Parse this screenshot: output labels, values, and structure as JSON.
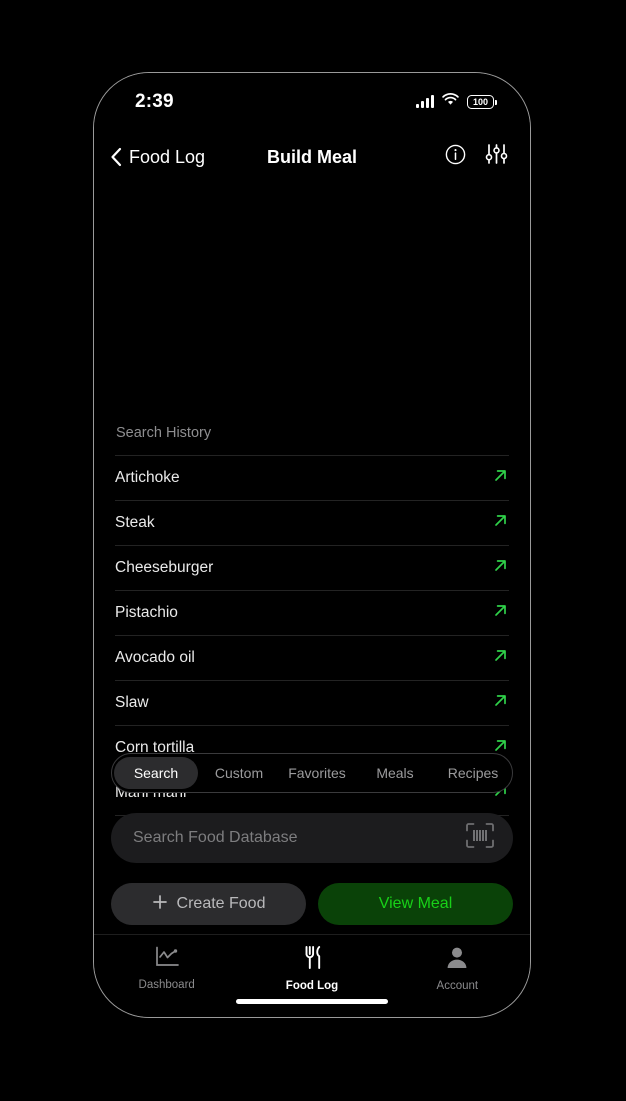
{
  "status_bar": {
    "time": "2:39",
    "signal_icon": "cellular-signal-icon",
    "wifi_icon": "wifi-icon",
    "battery_level": "100"
  },
  "nav": {
    "back_label": "Food Log",
    "back_icon": "chevron-left-icon",
    "title": "Build Meal",
    "info_icon": "info-circle-icon",
    "filter_icon": "sliders-icon"
  },
  "history": {
    "title": "Search History",
    "row_arrow_icon": "arrow-up-right-icon",
    "items": [
      {
        "name": "Artichoke"
      },
      {
        "name": "Steak"
      },
      {
        "name": "Cheeseburger"
      },
      {
        "name": "Pistachio"
      },
      {
        "name": "Avocado oil"
      },
      {
        "name": "Slaw"
      },
      {
        "name": "Corn tortilla"
      },
      {
        "name": "Mahi mahi"
      },
      {
        "name": ""
      }
    ]
  },
  "segmented_control": {
    "selected": "Search",
    "tabs": [
      {
        "label": "Search"
      },
      {
        "label": "Custom"
      },
      {
        "label": "Favorites"
      },
      {
        "label": "Meals"
      },
      {
        "label": "Recipes"
      }
    ]
  },
  "search": {
    "placeholder": "Search Food Database",
    "value": "",
    "barcode_icon": "barcode-scan-icon"
  },
  "actions": {
    "create_food_label": "Create Food",
    "create_food_icon": "plus-icon",
    "view_meal_label": "View Meal"
  },
  "tab_bar": {
    "active": "Food Log",
    "tabs": [
      {
        "label": "Dashboard",
        "icon": "chart-line-icon"
      },
      {
        "label": "Food Log",
        "icon": "fork-knife-icon"
      },
      {
        "label": "Account",
        "icon": "person-icon"
      }
    ]
  },
  "colors": {
    "background": "#000000",
    "accent_green": "#2fd24a",
    "view_meal_bg": "#0a4208",
    "view_meal_text": "#18d118",
    "surface": "#1c1c1e",
    "surface_raised": "#2c2c2e",
    "text_primary": "#ffffff",
    "text_secondary": "#8e8e90",
    "separator": "#232323"
  }
}
